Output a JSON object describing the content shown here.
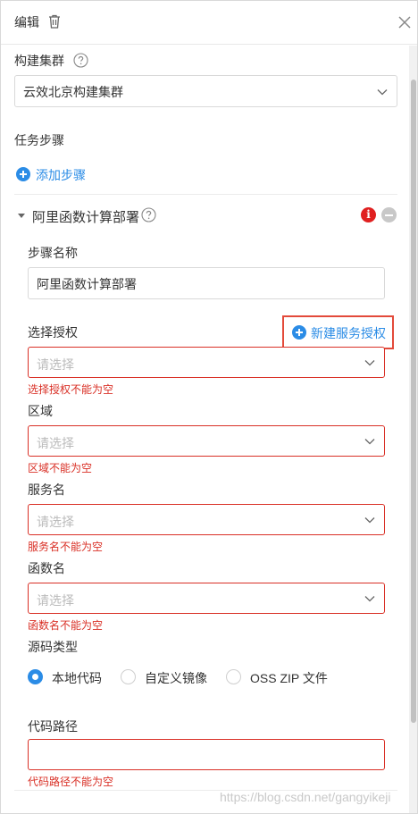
{
  "header": {
    "title": "编辑"
  },
  "build_cluster": {
    "label": "构建集群",
    "value": "云效北京构建集群"
  },
  "task_steps": {
    "label": "任务步骤",
    "add_step": "添加步骤"
  },
  "step": {
    "title": "阿里函数计算部署",
    "info_badge": "i",
    "name_label": "步骤名称",
    "name_value": "阿里函数计算部署",
    "auth_label": "选择授权",
    "new_auth": "新建服务授权",
    "auth_placeholder": "请选择",
    "auth_error": "选择授权不能为空",
    "region_label": "区域",
    "region_placeholder": "请选择",
    "region_error": "区域不能为空",
    "service_label": "服务名",
    "service_placeholder": "请选择",
    "service_error": "服务名不能为空",
    "function_label": "函数名",
    "function_placeholder": "请选择",
    "function_error": "函数名不能为空",
    "source_type_label": "源码类型",
    "source_options": [
      "本地代码",
      "自定义镜像",
      "OSS ZIP 文件"
    ],
    "source_selected": "本地代码",
    "code_path_label": "代码路径",
    "code_path_value": "",
    "code_path_error": "代码路径不能为空"
  },
  "watermark": "https://blog.csdn.net/gangyikeji",
  "colors": {
    "accent": "#2b8ce6",
    "error": "#d93026",
    "highlight_box": "#e34a3a"
  }
}
